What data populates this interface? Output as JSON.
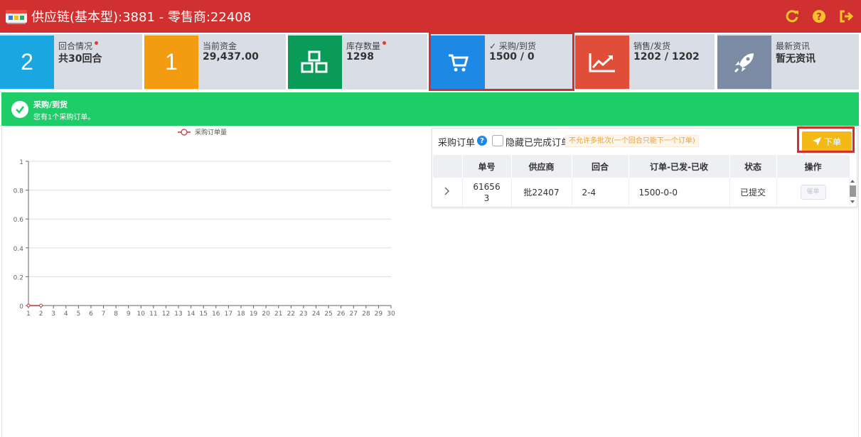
{
  "app": {
    "title": "供应链(基本型):3881 - 零售商:22408",
    "header_icons": [
      "refresh-icon",
      "help-icon",
      "logout-icon"
    ],
    "brand_color": "#d03030"
  },
  "tiles": [
    {
      "id": "rounds",
      "big": "2",
      "label": "回合情况",
      "value": "共30回合",
      "color": "#1aa6e0",
      "alert": true
    },
    {
      "id": "funds",
      "big": "1",
      "label": "当前资金",
      "value": "29,437.00",
      "color": "#f39c12",
      "alert": false
    },
    {
      "id": "inventory",
      "icon": "cubes-icon",
      "label": "库存数量",
      "value": "1298",
      "color": "#0a9b58",
      "alert": true
    },
    {
      "id": "purchase",
      "icon": "cart-icon",
      "label": "✓ 采购/到货",
      "value": "1500 / 0",
      "color": "#1e88e5",
      "alert": false,
      "highlighted": true
    },
    {
      "id": "sales",
      "icon": "line-chart-icon",
      "label": "销售/发货",
      "value": "1202 / 1202",
      "color": "#e04e3a",
      "alert": false
    },
    {
      "id": "news",
      "icon": "rocket-icon",
      "label": "最新资讯",
      "value": "暂无资讯",
      "color": "#7a8ba3",
      "alert": false
    }
  ],
  "banner": {
    "title": "采购/到货",
    "subtitle": "您有1个采购订单。",
    "color": "#1ecd68"
  },
  "chart_data": {
    "type": "line",
    "legend": [
      "采购订单量"
    ],
    "x": [
      1,
      2,
      3,
      4,
      5,
      6,
      7,
      8,
      9,
      10,
      11,
      12,
      13,
      14,
      15,
      16,
      17,
      18,
      19,
      20,
      21,
      22,
      23,
      24,
      25,
      26,
      27,
      28,
      29,
      30
    ],
    "series": [
      {
        "name": "采购订单量",
        "x": [
          1,
          2
        ],
        "values": [
          0,
          0
        ],
        "color": "#c23531"
      }
    ],
    "y_ticks": [
      "0",
      "0.2",
      "0.4",
      "0.6",
      "0.8",
      "1"
    ],
    "ylim": [
      0,
      1
    ],
    "xlim": [
      1,
      30
    ],
    "grid": true,
    "legend_position": "top-center"
  },
  "orders": {
    "title": "采购订单",
    "hide_completed_label": "隐藏已完成订单",
    "hide_completed_checked": false,
    "note": "不允许多批次(一个回合只能下一个订单)",
    "order_button": "下单",
    "columns": [
      "",
      "单号",
      "供应商",
      "回合",
      "订单-已发-已收",
      "状态",
      "操作"
    ],
    "rows": [
      {
        "id_line1": "61656",
        "id_line2": "3",
        "supplier": "批22407",
        "round": "2-4",
        "qty": "1500-0-0",
        "status": "已提交",
        "action": "催单"
      }
    ]
  }
}
